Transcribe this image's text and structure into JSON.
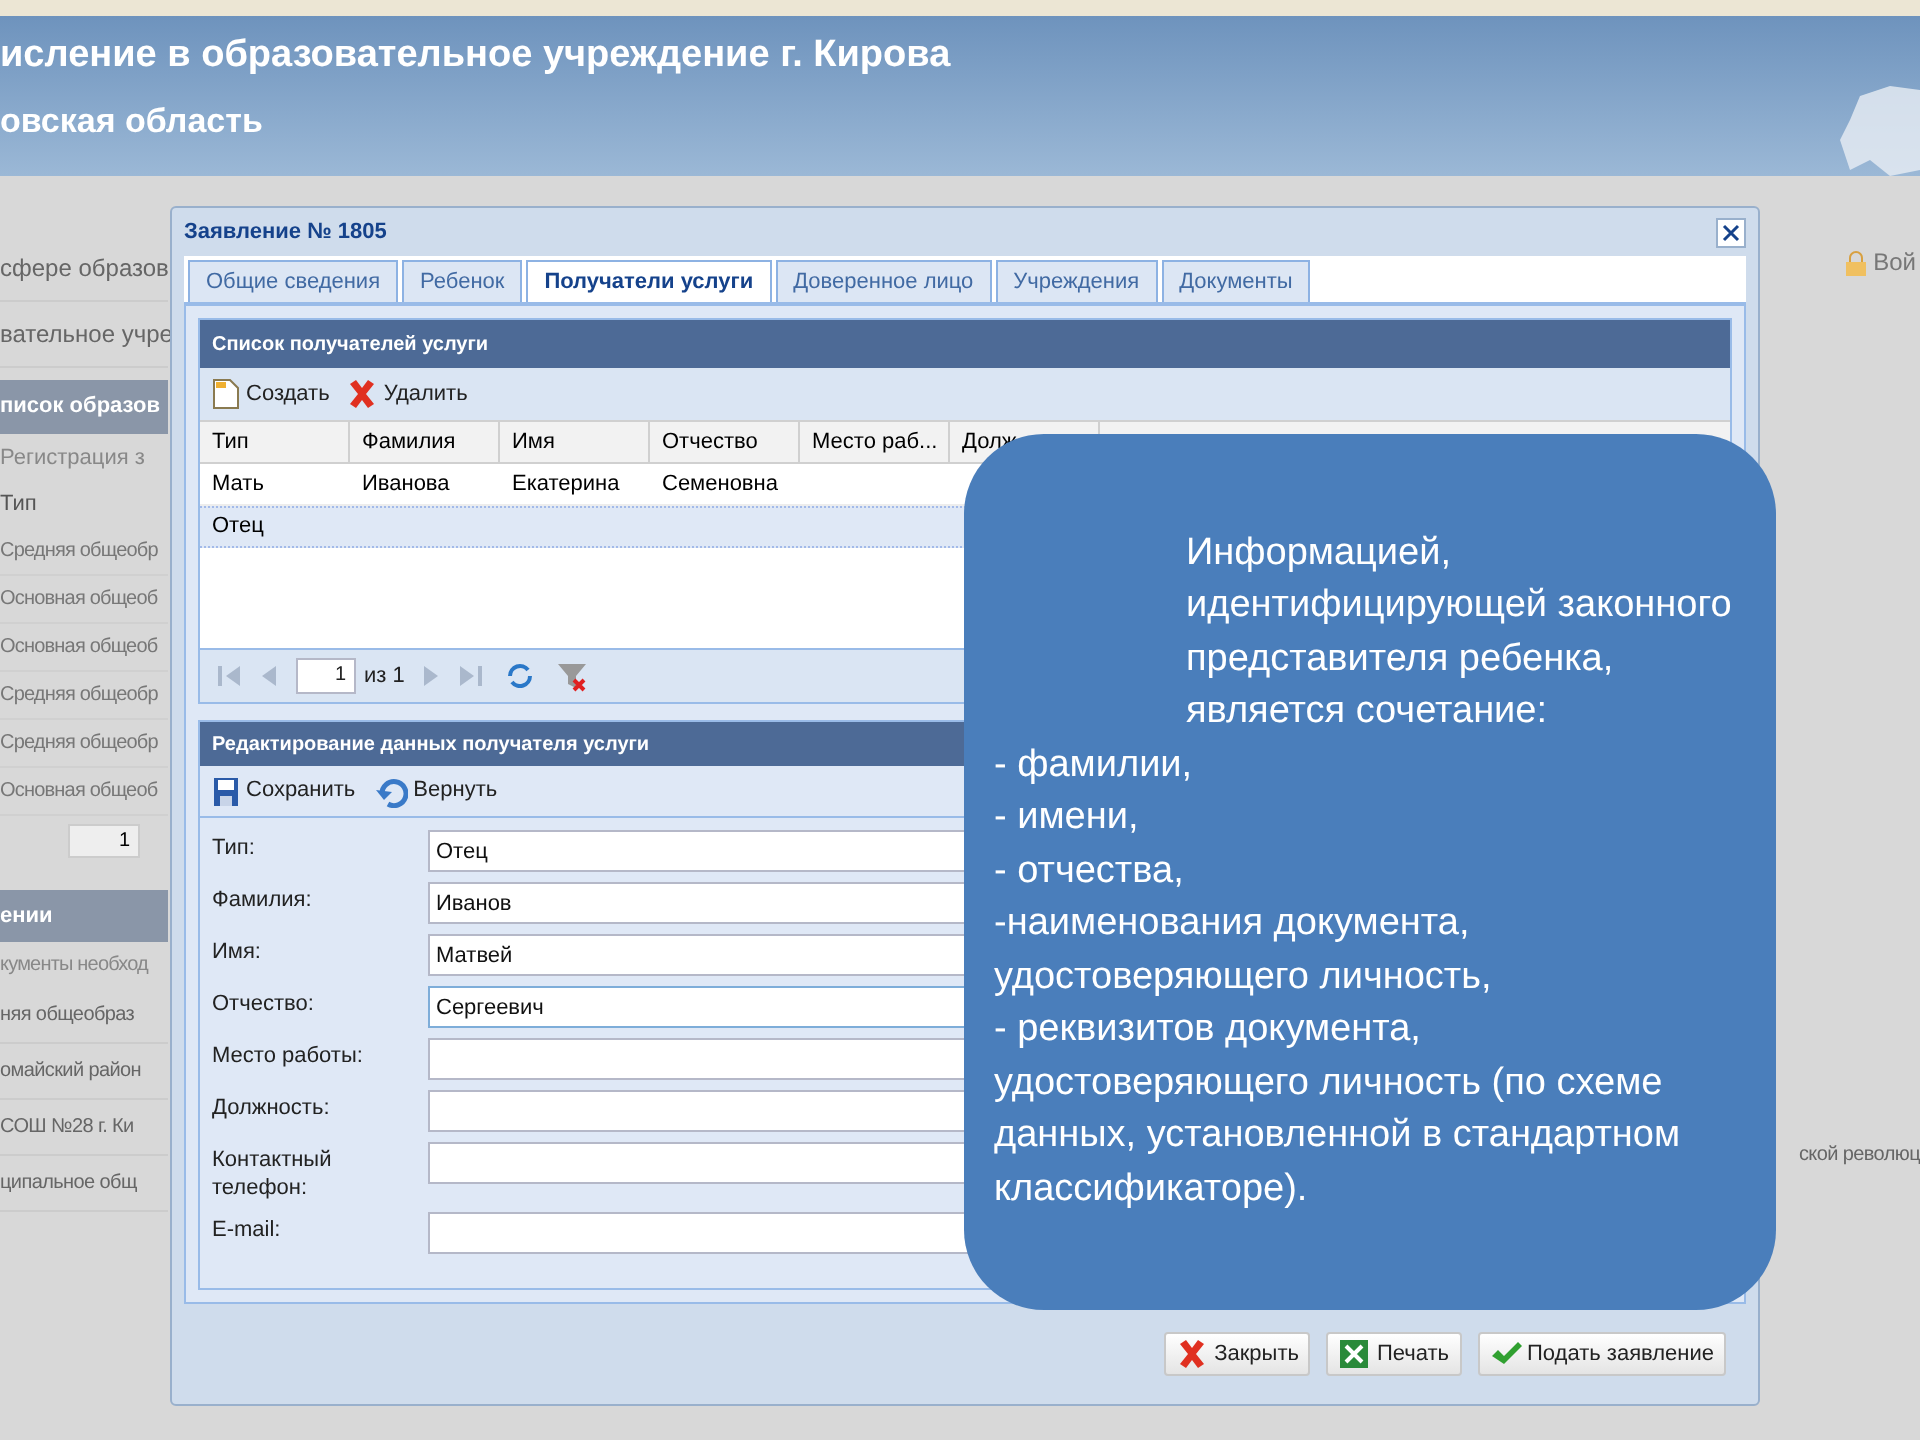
{
  "header": {
    "title": "исление в образовательное учреждение г. Кирова",
    "subtitle": "овская область",
    "login": "Вой"
  },
  "background": {
    "nav": [
      "сфере образов",
      "вательное учре"
    ],
    "list_title": "писок образов",
    "register": "Регистрация з",
    "column": "Тип",
    "rows": [
      "Средняя общеобр",
      "Основная общеоб",
      "Основная общеоб",
      "Средняя общеобр",
      "Средняя общеобр",
      "Основная общеоб"
    ],
    "page": "1",
    "section_title": "ении",
    "note": "кументы необход",
    "details": [
      "няя общеобраз",
      "омайский район",
      "СОШ №28 г. Ки",
      "ципальное общ"
    ],
    "right_text": "ской революц"
  },
  "dialog": {
    "title": "Заявление № 1805",
    "tabs": [
      {
        "label": "Общие сведения",
        "selected": false
      },
      {
        "label": "Ребенок",
        "selected": false
      },
      {
        "label": "Получатели услуги",
        "selected": true
      },
      {
        "label": "Доверенное лицо",
        "selected": false
      },
      {
        "label": "Учреждения",
        "selected": false
      },
      {
        "label": "Документы",
        "selected": false
      }
    ],
    "list": {
      "title": "Список получателей услуги",
      "toolbar": [
        {
          "kind": "create",
          "label": "Создать"
        },
        {
          "kind": "delete",
          "label": "Удалить"
        }
      ],
      "columns": [
        "Тип",
        "Фамилия",
        "Имя",
        "Отчество",
        "Место раб...",
        "Долж"
      ],
      "rows": [
        {
          "cells": [
            "Мать",
            "Иванова",
            "Екатерина",
            "Семеновна"
          ],
          "selected": false
        },
        {
          "cells": [
            "Отец"
          ],
          "selected": true
        }
      ],
      "pager": {
        "page": "1",
        "total": "из 1"
      }
    },
    "editor": {
      "title": "Редактирование данных получателя услуги",
      "toolbar": [
        {
          "kind": "save",
          "label": "Сохранить"
        },
        {
          "kind": "revert",
          "label": "Вернуть"
        }
      ],
      "fields": [
        {
          "label": "Тип:",
          "value": "Отец",
          "focused": false
        },
        {
          "label": "Фамилия:",
          "value": "Иванов",
          "focused": false
        },
        {
          "label": "Имя:",
          "value": "Матвей",
          "focused": false
        },
        {
          "label": "Отчество:",
          "value": "Сергеевич",
          "focused": true
        },
        {
          "label": "Место работы:",
          "focused": false
        },
        {
          "label": "Должность:",
          "focused": false
        },
        {
          "label": "Контактный телефон:",
          "focused": false
        },
        {
          "label": "E-mail:",
          "focused": false
        }
      ]
    },
    "buttons": [
      {
        "kind": "close",
        "label": "Закрыть"
      },
      {
        "kind": "print",
        "label": "Печать"
      },
      {
        "kind": "submit",
        "label": "Подать заявление"
      }
    ]
  },
  "callout": {
    "intro": "Информацией, идентифицирующей законного представителя ребенка, является сочетание:",
    "items": [
      "- фамилии,",
      "- имени,",
      "- отчества,",
      "-наименования документа, удостоверяющего личность,",
      "- реквизитов документа, удостоверяющего личность (по схеме данных, установленной в стандартном классификаторе)."
    ]
  }
}
